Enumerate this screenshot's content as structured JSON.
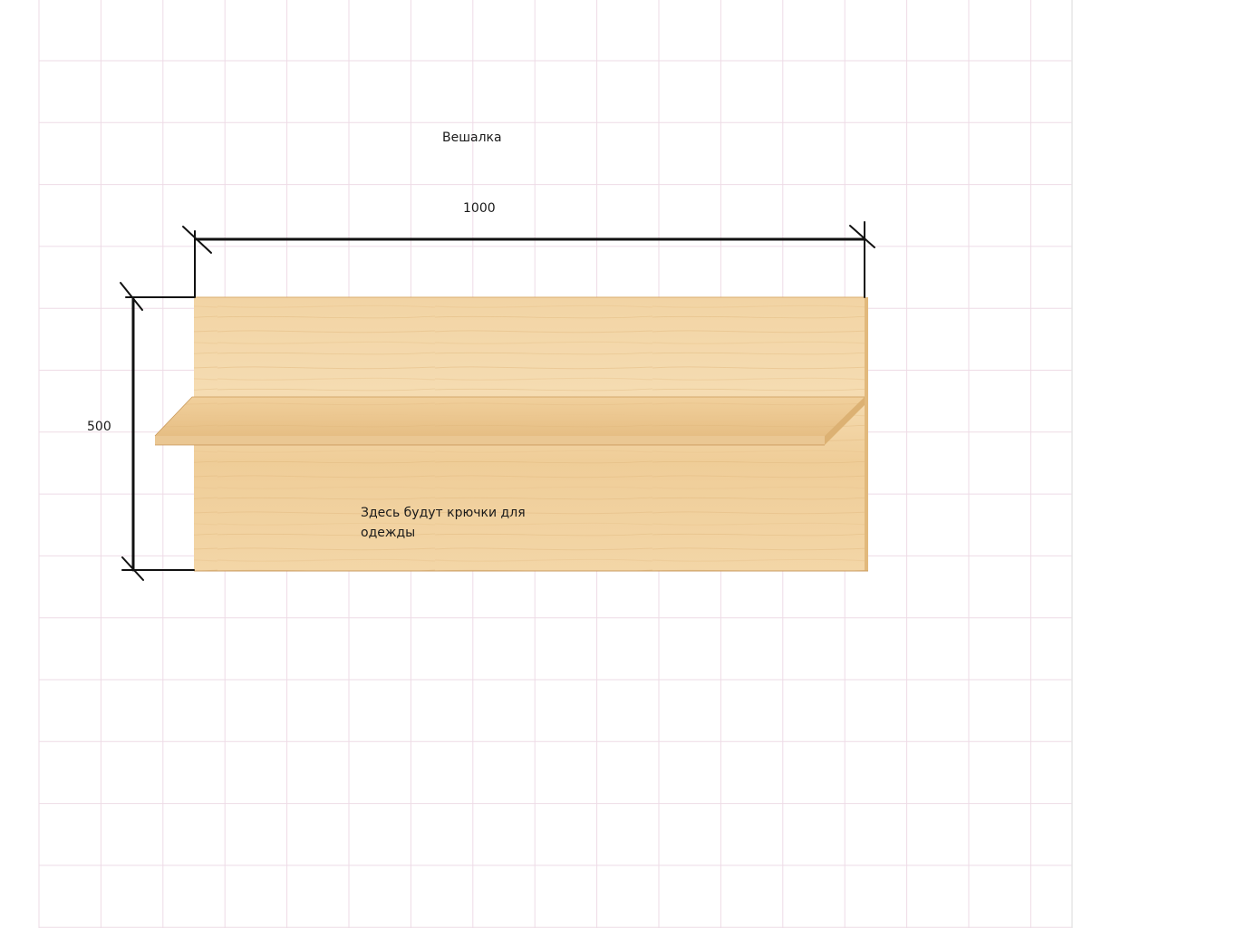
{
  "drawing": {
    "title": "Вешалка",
    "width_dimension": "1000",
    "height_dimension": "500",
    "note": "Здесь будут крючки для одежды"
  },
  "colors": {
    "grid_line": "#eedbe6",
    "wood_light": "#f4d9ad",
    "wood_mid": "#ecc994",
    "wood_dark": "#dfb67a",
    "dimension_line": "#111111"
  }
}
